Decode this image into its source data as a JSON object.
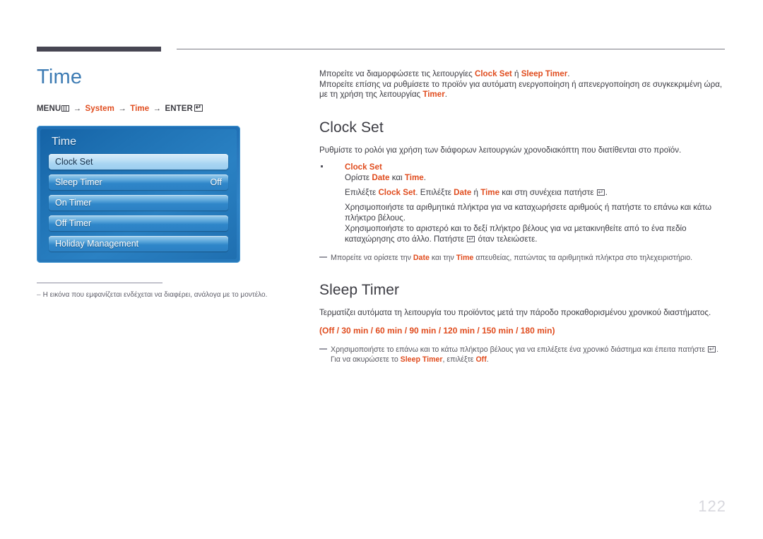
{
  "page": {
    "number": "122",
    "title": "Time"
  },
  "menu_path": {
    "prefix": "MENU",
    "menu_icon": "menu-grid-icon",
    "arrow": "→",
    "step1": "System",
    "step2": "Time",
    "enter_label": "ENTER",
    "enter_icon": "enter-return-icon"
  },
  "osd": {
    "title": "Time",
    "rows": [
      {
        "label": "Clock Set",
        "value": "",
        "selected": true
      },
      {
        "label": "Sleep Timer",
        "value": "Off",
        "selected": false
      },
      {
        "label": "On Timer",
        "value": "",
        "selected": false
      },
      {
        "label": "Off Timer",
        "value": "",
        "selected": false
      },
      {
        "label": "Holiday Management",
        "value": "",
        "selected": false
      }
    ]
  },
  "left_note": {
    "dash": "–",
    "text": "Η εικόνα που εμφανίζεται ενδέχεται να διαφέρει, ανάλογα με το μοντέλο."
  },
  "intro": {
    "line1_a": "Μπορείτε να διαμορφώσετε τις λειτουργίες ",
    "line1_hl1": "Clock Set",
    "line1_b": " ή ",
    "line1_hl2": "Sleep Timer",
    "line1_c": ".",
    "line2_a": "Μπορείτε επίσης να ρυθμίσετε το προϊόν για αυτόματη ενεργοποίηση ή απενεργοποίηση σε συγκεκριμένη ώρα, με τη χρήση της λειτουργίας ",
    "line2_hl": "Timer",
    "line2_b": "."
  },
  "clock_set": {
    "heading": "Clock Set",
    "description": "Ρυθμίστε το ρολόι για χρήση των διάφορων λειτουργιών χρονοδιακόπτη που διατίθενται στο προϊόν.",
    "bullet_title": "Clock Set",
    "b_l1_a": "Ορίστε ",
    "b_l1_hl1": "Date",
    "b_l1_b": " και ",
    "b_l1_hl2": "Time",
    "b_l1_c": ".",
    "b_l2_a": "Επιλέξτε ",
    "b_l2_hl1": "Clock Set",
    "b_l2_b": ". Επιλέξτε ",
    "b_l2_hl2": "Date",
    "b_l2_c": " ή ",
    "b_l2_hl3": "Time",
    "b_l2_d": " και στη συνέχεια πατήστε ",
    "b_l2_e": ".",
    "b_l3": "Χρησιμοποιήστε τα αριθμητικά πλήκτρα για να καταχωρήσετε αριθμούς ή πατήστε το επάνω και κάτω πλήκτρο βέλους.",
    "b_l4_a": "Χρησιμοποιήστε το αριστερό και το δεξί πλήκτρο βέλους για να μετακινηθείτε από το ένα πεδίο καταχώρησης στο άλλο. Πατήστε ",
    "b_l4_b": " όταν τελειώσετε.",
    "note_a": "Μπορείτε να ορίσετε την ",
    "note_hl1": "Date",
    "note_b": " και την ",
    "note_hl2": "Time",
    "note_c": " απευθείας, πατώντας τα αριθμητικά πλήκτρα στο τηλεχειριστήριο."
  },
  "sleep_timer": {
    "heading": "Sleep Timer",
    "description": "Τερματίζει αυτόματα τη λειτουργία του προϊόντος μετά την πάροδο προκαθορισμένου χρονικού διαστήματος.",
    "options_text": "(Off / 30 min / 60 min / 90 min / 120 min / 150 min / 180 min)",
    "options": [
      "Off",
      "30 min",
      "60 min",
      "90 min",
      "120 min",
      "150 min",
      "180 min"
    ],
    "note_a": "Χρησιμοποιήστε το επάνω και το κάτω πλήκτρο βέλους για να επιλέξετε ένα χρονικό διάστημα και έπειτα πατήστε ",
    "note_b": ". Για να ακυρώσετε το ",
    "note_hl1": "Sleep Timer",
    "note_c": ", επιλέξτε ",
    "note_hl2": "Off",
    "note_d": "."
  },
  "colors": {
    "accent_orange": "#e04c1e",
    "title_blue": "#3e7cb4",
    "rule_dark": "#474653",
    "osd_blue": "#2a79bd",
    "page_number_gray": "#d8d8de"
  }
}
